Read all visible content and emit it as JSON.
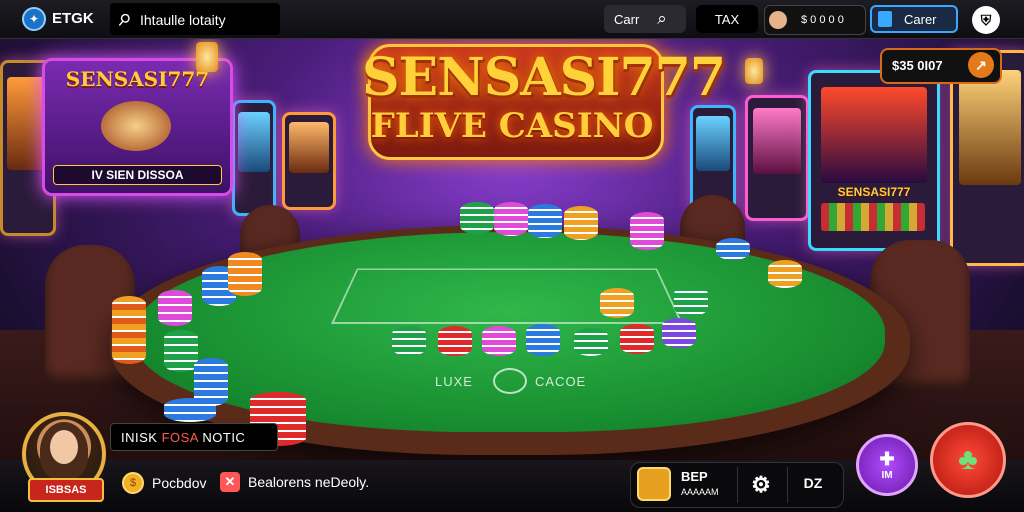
{
  "topbar": {
    "brand": "ETGK",
    "search_value": "Ihtaulle lotaity",
    "cart_label": "Carr",
    "tax_label": "TAX",
    "account_label": "$ 0 0 0 0",
    "career_label": "Carer",
    "shield_icon": "shield-icon"
  },
  "sign": {
    "title": "SENSASI777",
    "subtitle": "IV SIEN DISSOA"
  },
  "logo": {
    "main": "SENSASI777",
    "sub": "FLIVE CASINO"
  },
  "machine_right": {
    "label": "SENSASI777"
  },
  "balance": {
    "value": "$35 0I07"
  },
  "table": {
    "felt_left": "LUXE",
    "felt_right": "CACOE"
  },
  "bottom": {
    "avatar_tag": "ISBSAS",
    "notice_prefix": "INISK ",
    "notice_highlight": "FOSA",
    "notice_suffix": " NOTIC",
    "item1": "Pocbdov",
    "item2": "Bealorens neDeoly.",
    "panel_label_top": "BEP",
    "panel_label_bottom": "AAAAAM",
    "panel_btn": "DZ",
    "purple_btn_label": "IM"
  },
  "colors": {
    "accent": "#ffd23a",
    "felt": "#1f9a38",
    "purple_btn": "#8a2bd6",
    "red_btn": "#e0251d"
  }
}
